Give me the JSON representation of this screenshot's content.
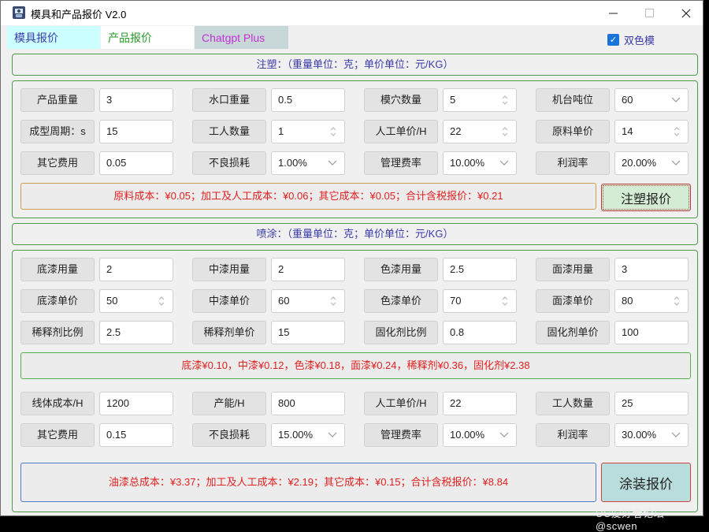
{
  "window": {
    "title": "模具和产品报价 V2.0"
  },
  "tabs": [
    "模具报价",
    "产品报价",
    "Chatgpt Plus"
  ],
  "dual_color": {
    "label": "双色模",
    "checked": true
  },
  "injection": {
    "header": "注塑：（重量单位：克；单价单位：元/KG）",
    "fields": [
      {
        "label": "产品重量",
        "value": "3",
        "kind": "text"
      },
      {
        "label": "水口重量",
        "value": "0.5",
        "kind": "text"
      },
      {
        "label": "模穴数量",
        "value": "5",
        "kind": "spin"
      },
      {
        "label": "机台吨位",
        "value": "60",
        "kind": "drop"
      },
      {
        "label": "成型周期：s",
        "value": "15",
        "kind": "text"
      },
      {
        "label": "工人数量",
        "value": "1",
        "kind": "spin"
      },
      {
        "label": "人工单价/H",
        "value": "22",
        "kind": "spin"
      },
      {
        "label": "原料单价",
        "value": "14",
        "kind": "spin"
      },
      {
        "label": "其它费用",
        "value": "0.05",
        "kind": "text"
      },
      {
        "label": "不良损耗",
        "value": "1.00%",
        "kind": "drop"
      },
      {
        "label": "管理费率",
        "value": "10.00%",
        "kind": "drop"
      },
      {
        "label": "利润率",
        "value": "20.00%",
        "kind": "drop"
      }
    ],
    "result": "原料成本：¥0.05；加工及人工成本：¥0.06；其它成本：¥0.05；合计含税报价：¥0.21",
    "button": "注塑报价"
  },
  "spray": {
    "header": "喷涂：（重量单位：克；单价单位：元/KG）",
    "fields": [
      {
        "label": "底漆用量",
        "value": "2",
        "kind": "text"
      },
      {
        "label": "中漆用量",
        "value": "2",
        "kind": "text"
      },
      {
        "label": "色漆用量",
        "value": "2.5",
        "kind": "text"
      },
      {
        "label": "面漆用量",
        "value": "3",
        "kind": "text"
      },
      {
        "label": "底漆单价",
        "value": "50",
        "kind": "spin"
      },
      {
        "label": "中漆单价",
        "value": "60",
        "kind": "spin"
      },
      {
        "label": "色漆单价",
        "value": "70",
        "kind": "spin"
      },
      {
        "label": "面漆单价",
        "value": "80",
        "kind": "spin"
      },
      {
        "label": "稀释剂比例",
        "value": "2.5",
        "kind": "text"
      },
      {
        "label": "稀释剂单价",
        "value": "15",
        "kind": "text"
      },
      {
        "label": "固化剂比例",
        "value": "0.8",
        "kind": "text"
      },
      {
        "label": "固化剂单价",
        "value": "100",
        "kind": "text"
      }
    ],
    "paint_result": "底漆¥0.10，中漆¥0.12，色漆¥0.18，面漆¥0.24，稀释剂¥0.36，固化剂¥2.38",
    "fields2": [
      {
        "label": "线体成本/H",
        "value": "1200",
        "kind": "text"
      },
      {
        "label": "产能/H",
        "value": "800",
        "kind": "text"
      },
      {
        "label": "人工单价/H",
        "value": "22",
        "kind": "text"
      },
      {
        "label": "工人数量",
        "value": "25",
        "kind": "text"
      },
      {
        "label": "其它费用",
        "value": "0.15",
        "kind": "text"
      },
      {
        "label": "不良损耗",
        "value": "15.00%",
        "kind": "drop"
      },
      {
        "label": "管理费率",
        "value": "10.00%",
        "kind": "drop"
      },
      {
        "label": "利润率",
        "value": "30.00%",
        "kind": "drop"
      }
    ],
    "result": "油漆总成本：¥3.37；加工及人工成本：¥2.19；其它成本：¥0.15；合计含税报价：¥8.84",
    "button": "涂装报价"
  },
  "watermark": "UC爱好者论坛@scwen"
}
